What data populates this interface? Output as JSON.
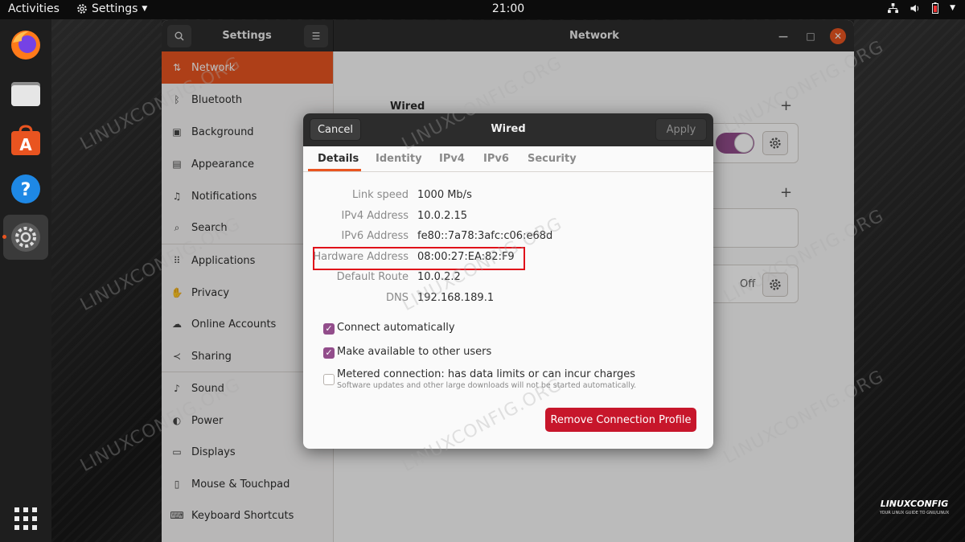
{
  "topbar": {
    "activities": "Activities",
    "app_menu": "Settings",
    "clock": "21:00"
  },
  "dock": {
    "apps": [
      "firefox-icon",
      "files-icon",
      "software-icon",
      "help-icon",
      "settings-icon",
      "show-apps-icon"
    ]
  },
  "window": {
    "sidebar_title": "Settings",
    "panel_title": "Network",
    "sidebar_items": [
      {
        "label": "Network",
        "icon": "network-icon",
        "active": true
      },
      {
        "label": "Bluetooth",
        "icon": "bluetooth-icon"
      },
      {
        "label": "Background",
        "icon": "background-icon"
      },
      {
        "label": "Appearance",
        "icon": "appearance-icon"
      },
      {
        "label": "Notifications",
        "icon": "bell-icon"
      },
      {
        "label": "Search",
        "icon": "search-icon"
      },
      {
        "label": "Applications",
        "icon": "grid-icon"
      },
      {
        "label": "Privacy",
        "icon": "hand-icon"
      },
      {
        "label": "Online Accounts",
        "icon": "cloud-icon"
      },
      {
        "label": "Sharing",
        "icon": "share-icon"
      },
      {
        "label": "Sound",
        "icon": "music-icon"
      },
      {
        "label": "Power",
        "icon": "power-icon"
      },
      {
        "label": "Displays",
        "icon": "display-icon"
      },
      {
        "label": "Mouse & Touchpad",
        "icon": "mouse-icon"
      },
      {
        "label": "Keyboard Shortcuts",
        "icon": "keyboard-icon"
      }
    ],
    "content": {
      "wired_heading": "Wired",
      "off_label": "Off"
    }
  },
  "dialog": {
    "cancel": "Cancel",
    "title": "Wired",
    "apply": "Apply",
    "tabs": [
      "Details",
      "Identity",
      "IPv4",
      "IPv6",
      "Security"
    ],
    "details": [
      {
        "key": "Link speed",
        "value": "1000 Mb/s"
      },
      {
        "key": "IPv4 Address",
        "value": "10.0.2.15"
      },
      {
        "key": "IPv6 Address",
        "value": "fe80::7a78:3afc:c06:e68d"
      },
      {
        "key": "Hardware Address",
        "value": "08:00:27:EA:82:F9"
      },
      {
        "key": "Default Route",
        "value": "10.0.2.2"
      },
      {
        "key": "DNS",
        "value": "192.168.189.1"
      }
    ],
    "checks": [
      {
        "label": "Connect automatically",
        "checked": true
      },
      {
        "label": "Make available to other users",
        "checked": true
      },
      {
        "label": "Metered connection: has data limits or can incur charges",
        "checked": false,
        "sub": "Software updates and other large downloads will not be started automatically."
      }
    ],
    "remove_button": "Remove Connection Profile"
  },
  "watermark": "LINUXCONFIG.ORG",
  "logo": {
    "brand": "LINUXCONFIG",
    "tagline": "YOUR LINUX GUIDE TO GNU/LINUX"
  },
  "colors": {
    "accent": "#e95420",
    "toggle": "#924d8b",
    "destructive": "#c7162b",
    "highlight": "#e0101a"
  }
}
